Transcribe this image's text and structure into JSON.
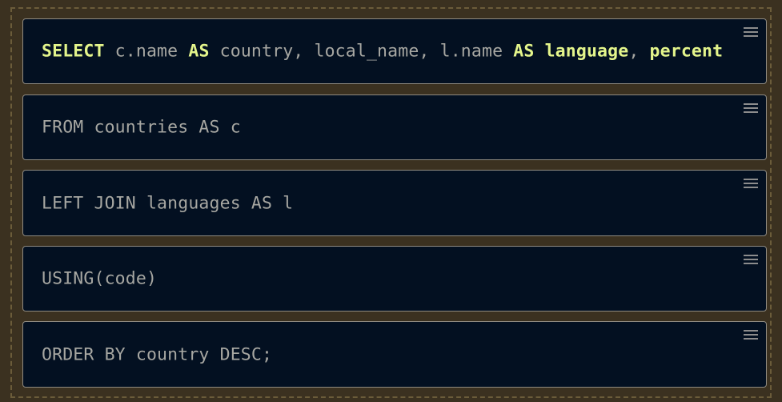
{
  "blocks": [
    {
      "id": "select",
      "segments": [
        {
          "text": "SELECT",
          "keyword": true
        },
        {
          "text": " c.name ",
          "keyword": false
        },
        {
          "text": "AS",
          "keyword": true
        },
        {
          "text": " country, local_name, l.name ",
          "keyword": false
        },
        {
          "text": "AS language",
          "keyword": true
        },
        {
          "text": ", ",
          "keyword": false
        },
        {
          "text": "percent",
          "keyword": true
        }
      ]
    },
    {
      "id": "from",
      "text": "FROM countries AS c"
    },
    {
      "id": "left-join",
      "text": "LEFT JOIN languages AS l"
    },
    {
      "id": "using",
      "text": "USING(code)"
    },
    {
      "id": "order-by",
      "text": "ORDER BY country DESC;"
    }
  ],
  "colors": {
    "background": "#3b3120",
    "block_bg": "#031021",
    "keyword": "#e4f58b",
    "text": "#a7a7a2"
  },
  "icons": {
    "drag_handle": "hamburger-icon"
  }
}
